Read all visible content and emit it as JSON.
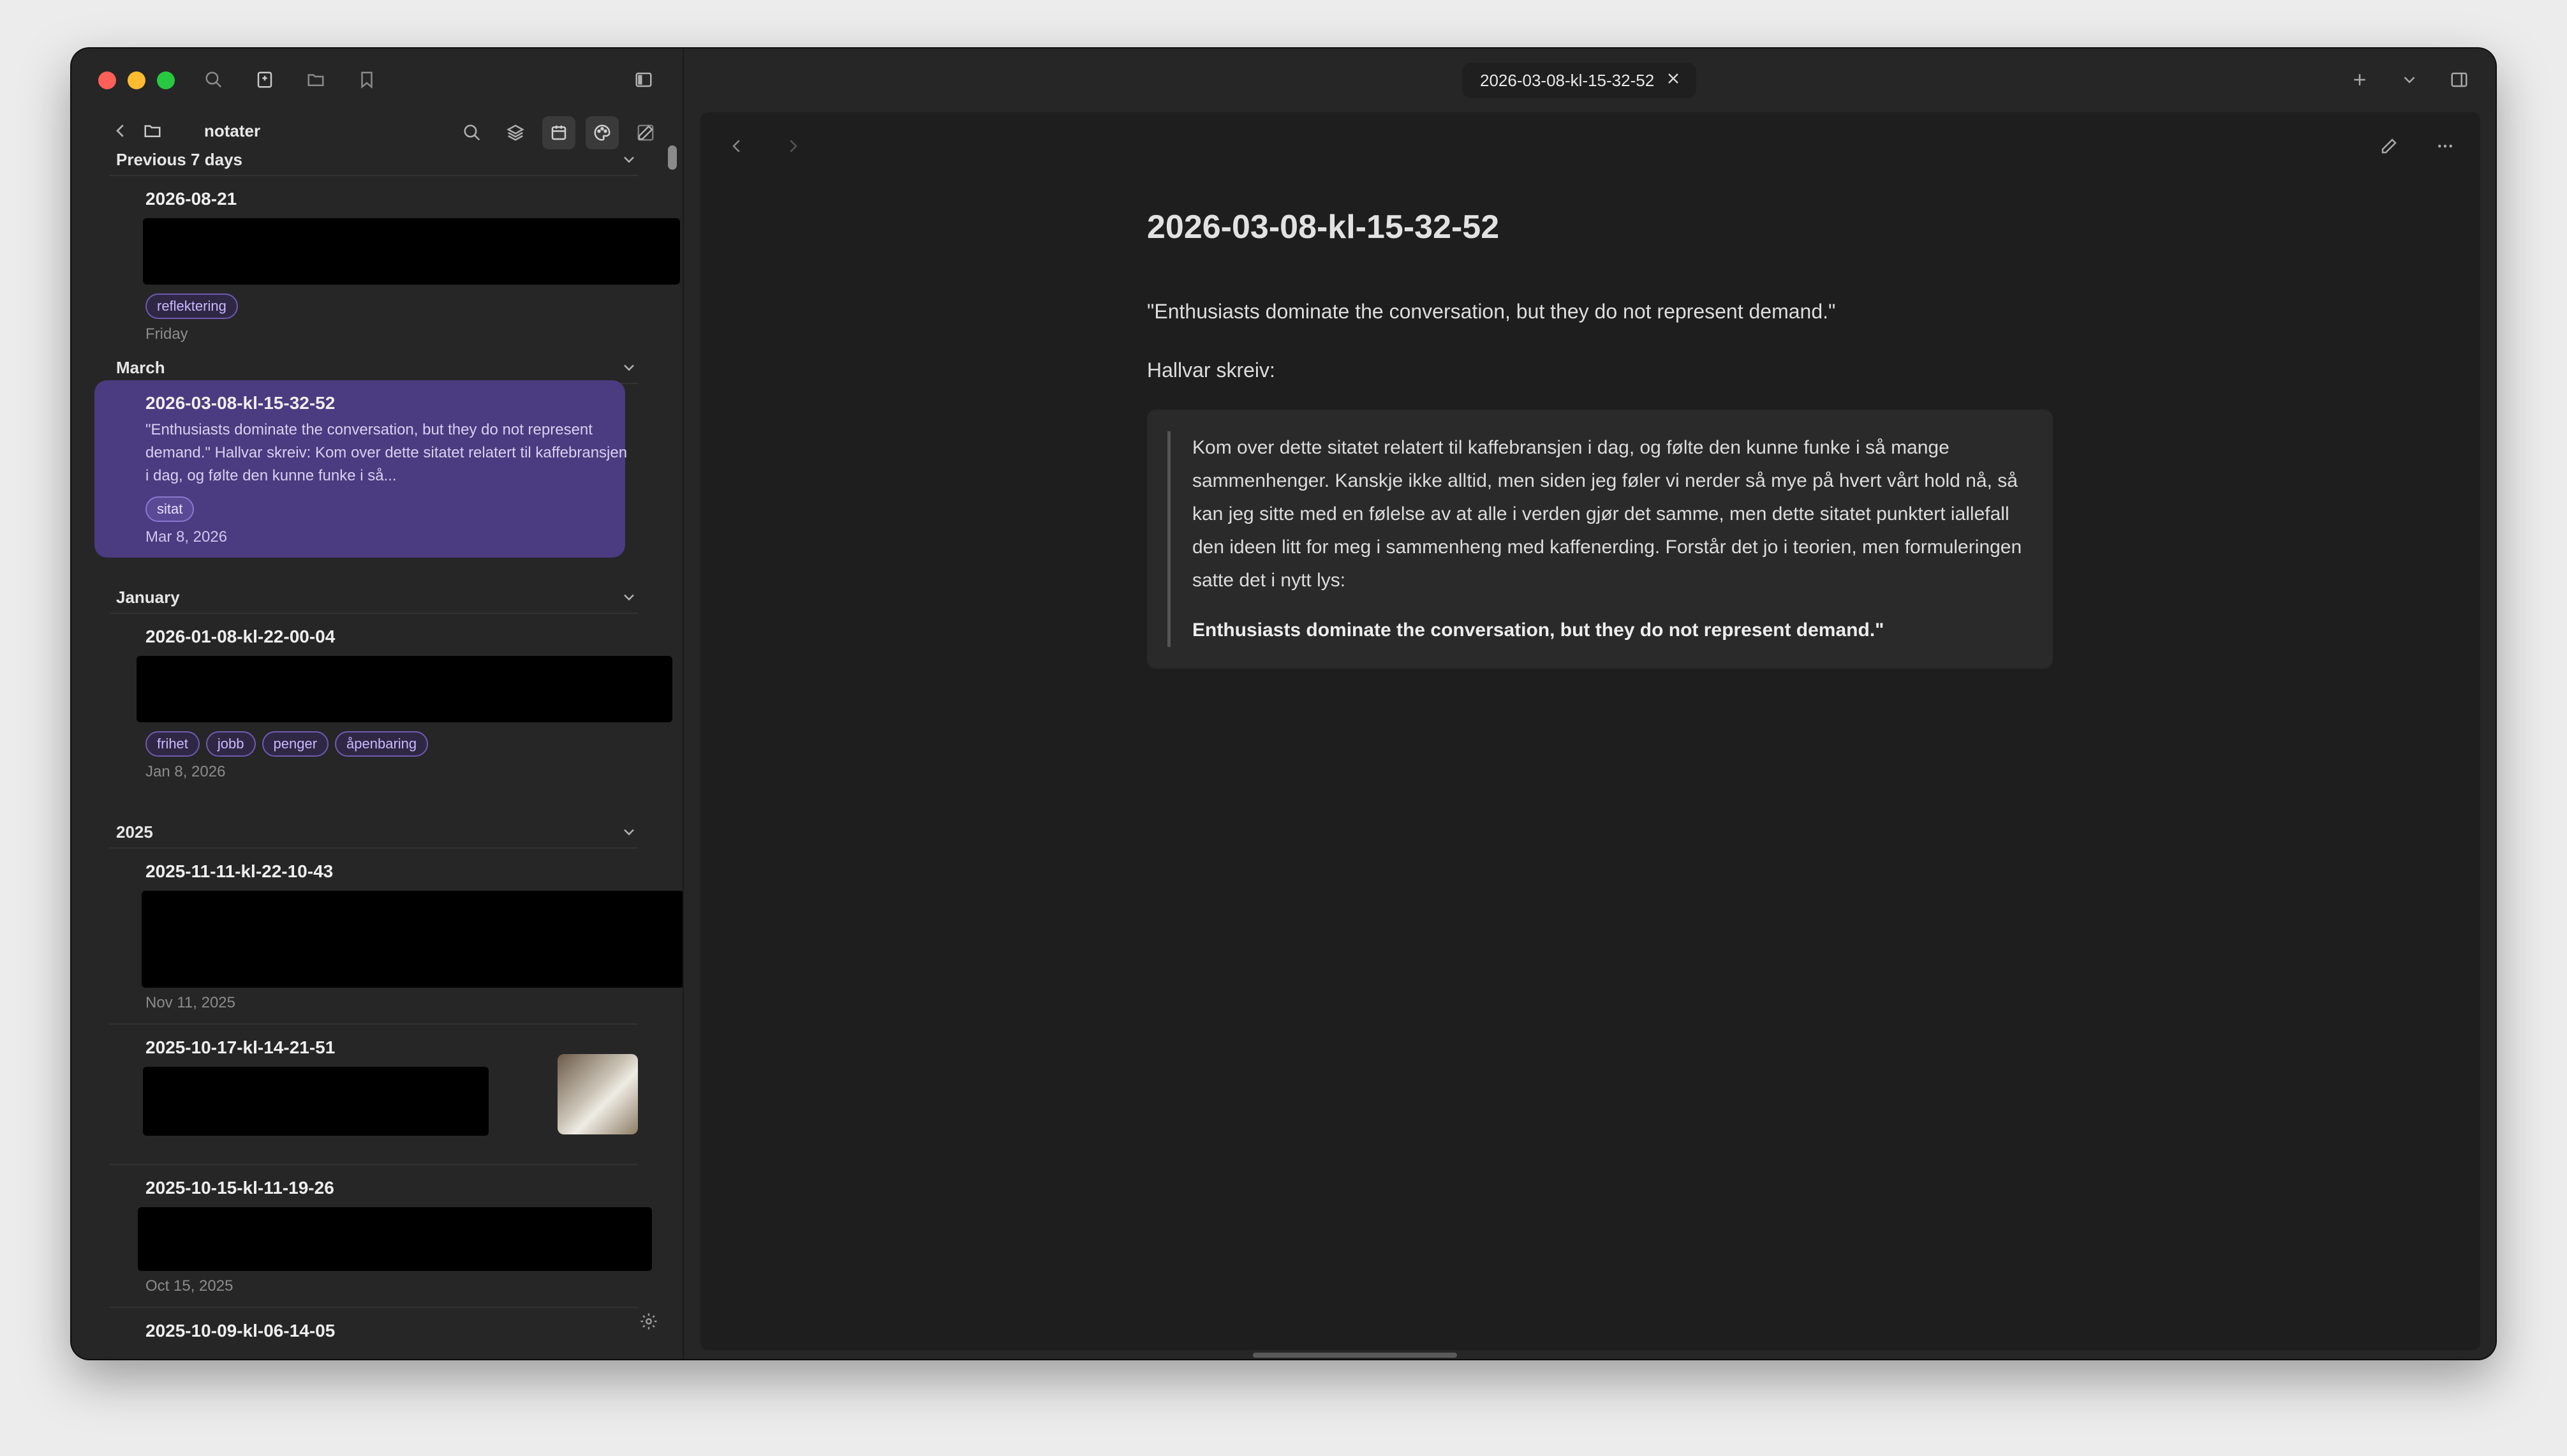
{
  "sidebar": {
    "vault_name": "notater",
    "sections": [
      {
        "label": "Previous 7 days",
        "items": [
          {
            "title": "2026-08-21",
            "tags": [
              "reflektering"
            ],
            "date": "Friday"
          }
        ]
      },
      {
        "label": "March",
        "items": [
          {
            "title": "2026-03-08-kl-15-32-52",
            "snippet": "\"Enthusiasts dominate the conversation, but they do not represent demand.\" Hallvar skreiv: Kom over dette sitatet relatert til kaffebransjen i dag, og følte den kunne funke i så...",
            "tags": [
              "sitat"
            ],
            "date": "Mar 8, 2026"
          }
        ]
      },
      {
        "label": "January",
        "items": [
          {
            "title": "2026-01-08-kl-22-00-04",
            "tags": [
              "frihet",
              "jobb",
              "penger",
              "åpenbaring"
            ],
            "date": "Jan 8, 2026"
          }
        ]
      },
      {
        "label": "2025",
        "items": [
          {
            "title": "2025-11-11-kl-22-10-43",
            "date": "Nov 11, 2025"
          },
          {
            "title": "2025-10-17-kl-14-21-51"
          },
          {
            "title": "2025-10-15-kl-11-19-26",
            "date": "Oct 15, 2025"
          },
          {
            "title": "2025-10-09-kl-06-14-05"
          }
        ]
      }
    ]
  },
  "tab": {
    "title": "2026-03-08-kl-15-32-52"
  },
  "note": {
    "title": "2026-03-08-kl-15-32-52",
    "quote_line": "\"Enthusiasts dominate the conversation, but they do not represent demand.\"",
    "author_line": "Hallvar skreiv:",
    "blockquote": "Kom over dette sitatet relatert til kaffebransjen i dag, og følte den kunne funke i så mange sammenhenger. Kanskje ikke alltid, men siden jeg føler vi nerder så mye på hvert vårt hold nå, så kan jeg sitte med en følelse av at alle i verden gjør det samme, men dette sitatet punktert iallefall den ideen litt for meg i sammenheng med kaffenerding. Forstår det jo i teorien, men formuleringen satte det i nytt lys:",
    "blockquote_bold": "Enthusiasts dominate the conversation, but they do not represent demand.\""
  },
  "colors": {
    "accent": "#4b3b80",
    "tag_text": "#c9b8ff",
    "background": "#1e1e1e"
  }
}
